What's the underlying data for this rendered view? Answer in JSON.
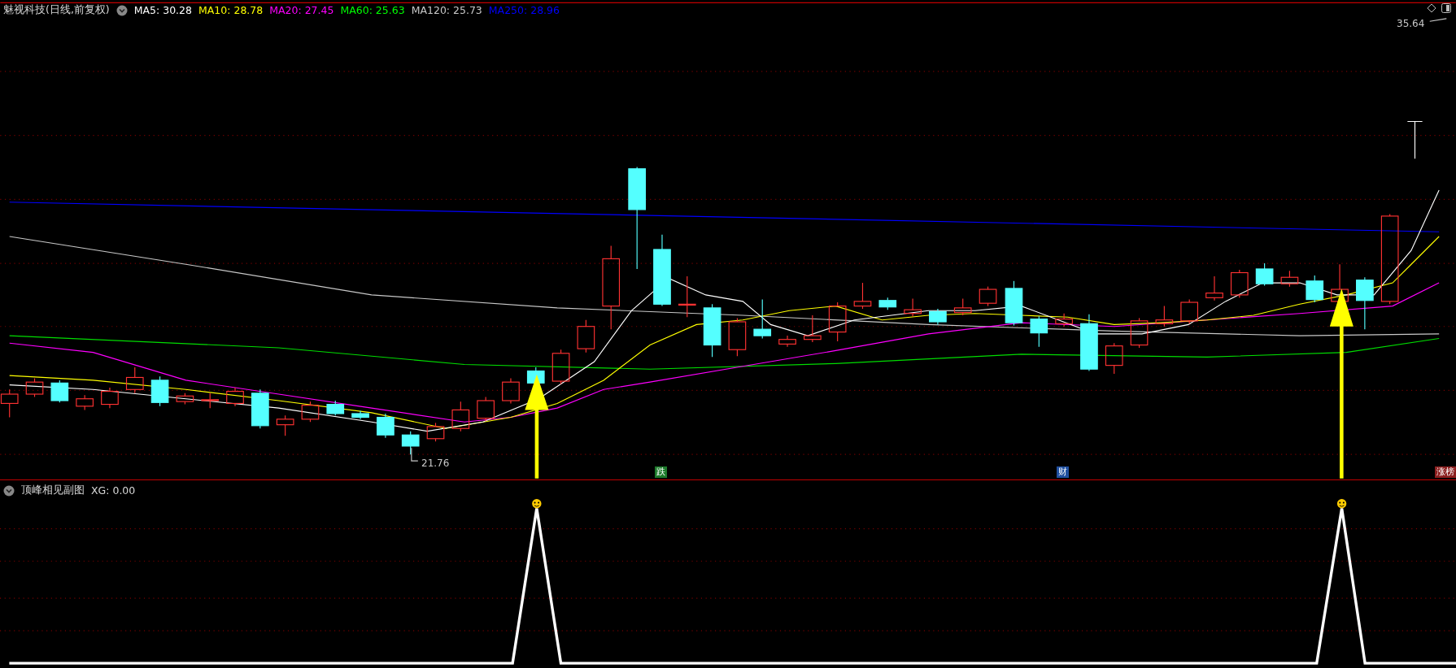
{
  "chart": {
    "title": "魅视科技(日线,前复权)",
    "indicators": [
      {
        "label": "MA5: 30.28",
        "color": "#ffffff"
      },
      {
        "label": "MA10: 28.78",
        "color": "#ffff00"
      },
      {
        "label": "MA20: 27.45",
        "color": "#ff00ff"
      },
      {
        "label": "MA60: 25.63",
        "color": "#00ff00"
      },
      {
        "label": "MA120: 25.73",
        "color": "#c8c8c8"
      },
      {
        "label": "MA250: 28.96",
        "color": "#0000ff"
      }
    ],
    "high_label": "35.64",
    "low_label": "21.76",
    "markers": [
      {
        "label": "跌",
        "color": "#1c7a2a"
      },
      {
        "label": "财",
        "color": "#1f4fa0"
      },
      {
        "label": "涨榜",
        "color": "#8c1f1f"
      }
    ]
  },
  "sub_chart": {
    "title": "顶峰相见副图",
    "reading": "XG: 0.00"
  }
}
